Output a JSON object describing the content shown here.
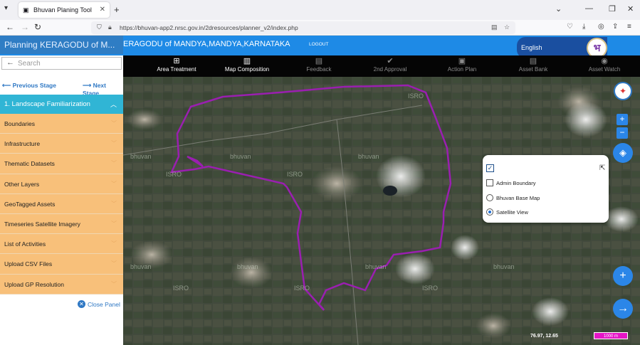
{
  "browser": {
    "tab_title": "Bhuvan Planing Tool",
    "url": "https://bhuvan-app2.nrsc.gov.in/2dresources/planner_v2/index.php"
  },
  "header": {
    "title_short": "Planning KERAGODU of M...",
    "title_rest": "ERAGODU of MANDYA,MANDYA,KARNATAKA",
    "logout": "LOGOUT",
    "language": "English",
    "logo_char": "भ"
  },
  "toolbar": {
    "items": [
      {
        "label": "Area Treatment",
        "icon": "plus-square-icon",
        "glyph": "⊞",
        "active": true
      },
      {
        "label": "Map Composition",
        "icon": "map-icon",
        "glyph": "▥",
        "active": true
      },
      {
        "label": "Feedback",
        "icon": "comment-icon",
        "glyph": "▤",
        "active": false
      },
      {
        "label": "2nd Approval",
        "icon": "check-circle-icon",
        "glyph": "✔",
        "active": false
      },
      {
        "label": "Action Plan",
        "icon": "save-icon",
        "glyph": "▣",
        "active": false
      },
      {
        "label": "Asset Bank",
        "icon": "bank-icon",
        "glyph": "▤",
        "active": false
      },
      {
        "label": "Asset Watch",
        "icon": "eye-icon",
        "glyph": "◉",
        "active": false
      }
    ]
  },
  "panel": {
    "search_placeholder": "Search",
    "prev_stage": "Previous Stage",
    "next_stage": "Next Stage",
    "active_stage": "1. Landscape Familiarization",
    "items": [
      "Boundaries",
      "Infrastructure",
      "Thematic Datasets",
      "Other Layers",
      "GeoTagged Assets",
      "Timeseries Satellite Imagery",
      "List of Activities",
      "Upload CSV Files",
      "Upload GP Resolution"
    ],
    "close_panel": "Close Panel"
  },
  "layers": {
    "admin_boundary": "Admin Boundary",
    "bhuvan_base_map": "Bhuvan Base Map",
    "satellite_view": "Satellite View",
    "selected": "Satellite View"
  },
  "map": {
    "coords": "76.97, 12.65",
    "scale": "1000 m",
    "zoom_in": "+",
    "zoom_out": "−"
  },
  "colors": {
    "header_blue": "#1e8ae6",
    "stage_cyan": "#30b5d5",
    "item_orange": "#f8c07a",
    "boundary_purple": "#9a1fb0"
  }
}
